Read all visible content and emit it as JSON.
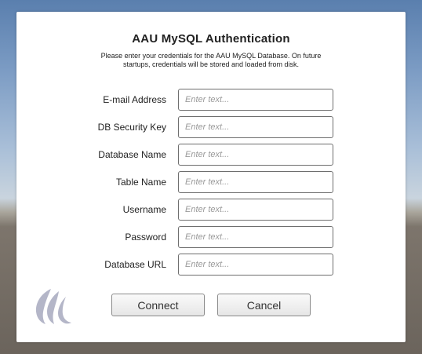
{
  "dialog": {
    "title": "AAU MySQL Authentication",
    "subtitle": "Please enter your credentials for the AAU MySQL Database. On future startups, credentials will be stored and loaded from disk."
  },
  "fields": [
    {
      "label": "E-mail Address",
      "placeholder": "Enter text..."
    },
    {
      "label": "DB Security Key",
      "placeholder": "Enter text..."
    },
    {
      "label": "Database Name",
      "placeholder": "Enter text..."
    },
    {
      "label": "Table Name",
      "placeholder": "Enter text..."
    },
    {
      "label": "Username",
      "placeholder": "Enter text..."
    },
    {
      "label": "Password",
      "placeholder": "Enter text..."
    },
    {
      "label": "Database URL",
      "placeholder": "Enter text..."
    }
  ],
  "buttons": {
    "connect": "Connect",
    "cancel": "Cancel"
  },
  "logo": {
    "icon": "aau-wave-logo-icon",
    "color": "#b4b6c8"
  }
}
